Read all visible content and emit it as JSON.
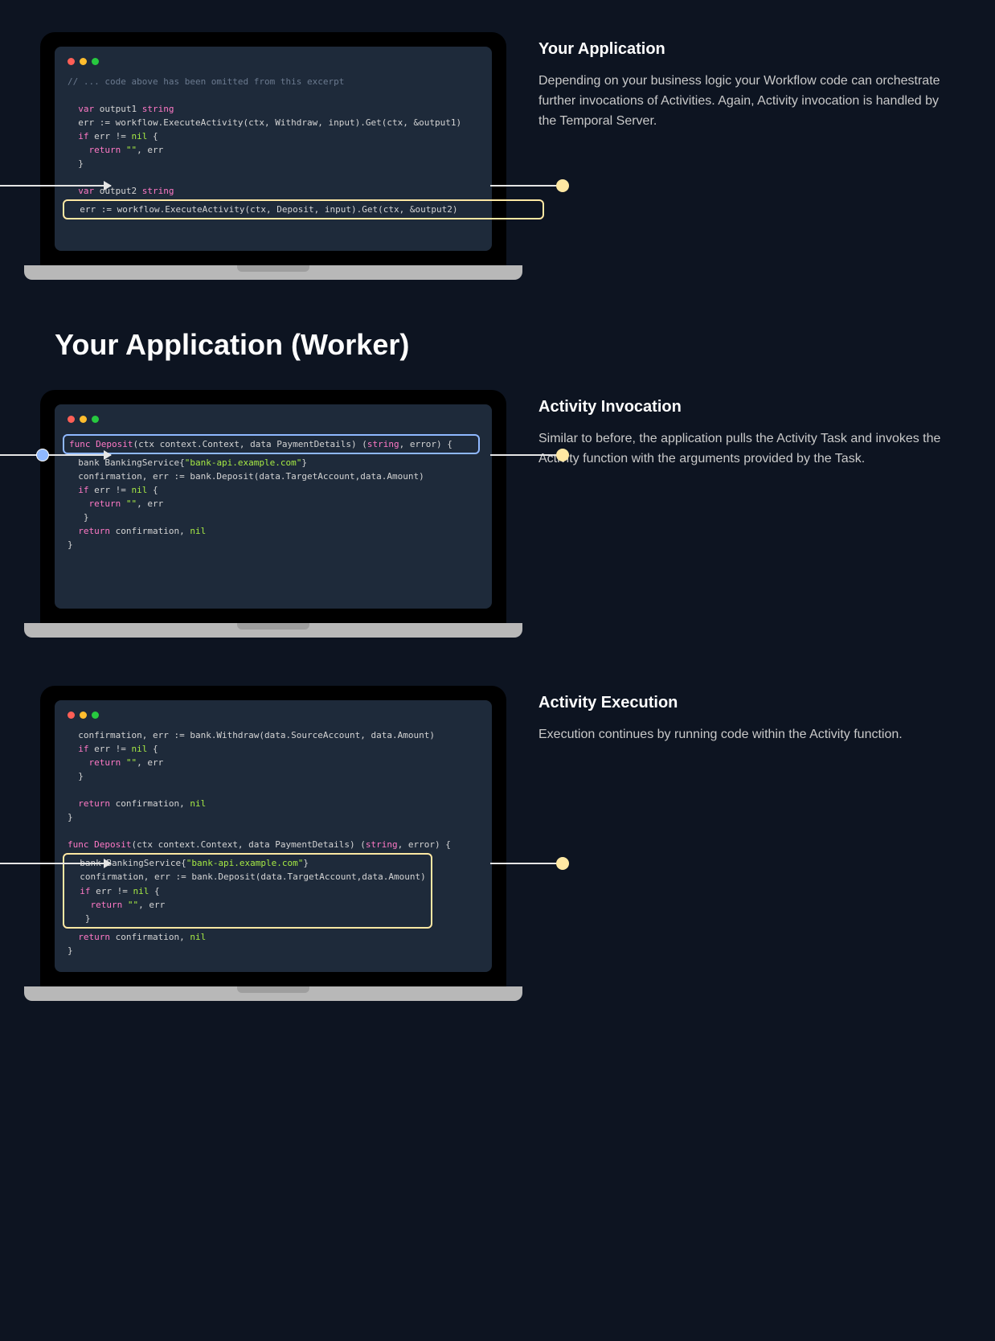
{
  "section1": {
    "title": "Your Application",
    "body": "Depending on your business logic your Workflow code can orchestrate further invocations of Activities. Again, Activity invocation is handled by the Temporal Server.",
    "code": {
      "comment": "// ... code above has been omitted from this excerpt",
      "line1_a": "var",
      "line1_b": " output1 ",
      "line1_c": "string",
      "line2_a": "err := workflow.ExecuteActivity(ctx, Withdraw, input).Get(ctx, &output1)",
      "line3_a": "if",
      "line3_b": " err != ",
      "line3_c": "nil",
      "line3_d": " {",
      "line4_a": "return ",
      "line4_b": "\"\"",
      "line4_c": ", err",
      "line5": "}",
      "line6_a": "var",
      "line6_b": " output2 ",
      "line6_c": "string",
      "hl": "err := workflow.ExecuteActivity(ctx, Deposit, input).Get(ctx, &output2)"
    }
  },
  "section_header": "Your Application (Worker)",
  "section2": {
    "title": "Activity Invocation",
    "body": "Similar to before, the application pulls the Activity Task and invokes the Activity function with the arguments provided by the Task.",
    "code": {
      "hl_a": "func ",
      "hl_b": "Deposit",
      "hl_c": "(ctx context.Context, data PaymentDetails) (",
      "hl_d": "string",
      "hl_e": ", error) {",
      "line2_a": "bank BankingService{",
      "line2_b": "\"bank-api.example.com\"",
      "line2_c": "}",
      "line3": "confirmation, err := bank.Deposit(data.TargetAccount,data.Amount)",
      "line4_a": "if",
      "line4_b": " err != ",
      "line4_c": "nil",
      "line4_d": " {",
      "line5_a": "return ",
      "line5_b": "\"\"",
      "line5_c": ", err",
      "line6": "}",
      "line7_a": "return",
      "line7_b": " confirmation, ",
      "line7_c": "nil",
      "line8": "}"
    }
  },
  "section3": {
    "title": "Activity Execution",
    "body": "Execution continues by running code within the Activity function.",
    "code": {
      "line1": "confirmation, err := bank.Withdraw(data.SourceAccount, data.Amount)",
      "line2_a": "if",
      "line2_b": " err != ",
      "line2_c": "nil",
      "line2_d": " {",
      "line3_a": "return ",
      "line3_b": "\"\"",
      "line3_c": ", err",
      "line4": "}",
      "line5_a": "return",
      "line5_b": " confirmation, ",
      "line5_c": "nil",
      "line6": "}",
      "line7_a": "func ",
      "line7_b": "Deposit",
      "line7_c": "(ctx context.Context, data PaymentDetails) (",
      "line7_d": "string",
      "line7_e": ", error) {",
      "hl1_a": "bank BankingService{",
      "hl1_b": "\"bank-api.example.com\"",
      "hl1_c": "}",
      "hl2": "confirmation, err := bank.Deposit(data.TargetAccount,data.Amount)",
      "hl3_a": "if",
      "hl3_b": " err != ",
      "hl3_c": "nil",
      "hl3_d": " {",
      "hl4_a": "return ",
      "hl4_b": "\"\"",
      "hl4_c": ", err",
      "hl5": "}",
      "line8_a": "return",
      "line8_b": " confirmation, ",
      "line8_c": "nil",
      "line9": "}"
    }
  }
}
